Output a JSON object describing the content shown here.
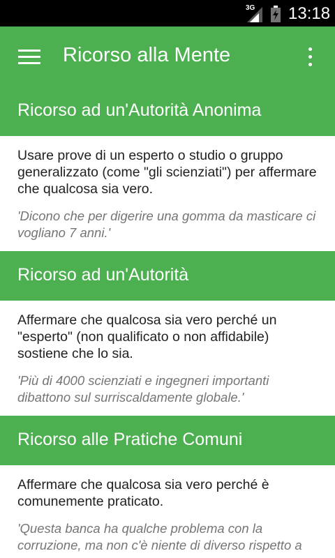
{
  "status_bar": {
    "network": "3G",
    "time": "13:18"
  },
  "app_bar": {
    "title": "Ricorso alla Mente"
  },
  "fallacies": [
    {
      "title": "Ricorso ad un'Autorità Anonima",
      "description": "Usare prove di un esperto o studio o gruppo generalizzato (come \"gli scienziati\") per affermare che qualcosa sia vero.",
      "example": "'Dicono che per digerire una gomma da masticare ci vogliano 7 anni.'"
    },
    {
      "title": "Ricorso ad un'Autorità",
      "description": "Affermare che qualcosa sia vero perché un \"esperto\" (non qualificato o non affidabile) sostiene che lo sia.",
      "example": "'Più di 4000 scienziati e ingegneri importanti dibattono sul surriscaldamente globale.'"
    },
    {
      "title": "Ricorso alle Pratiche Comuni",
      "description": "Affermare che qualcosa sia vero perché è comunemente praticato.",
      "example": "'Questa banca ha qualche problema con la corruzione, ma non c'è niente di diverso rispetto a"
    }
  ],
  "colors": {
    "primary": "#4caf50",
    "status_bar": "#000000",
    "text": "#212121",
    "example_text": "#757575"
  },
  "icons": {
    "menu": "hamburger-menu-icon",
    "overflow": "more-vertical-icon",
    "signal": "signal-icon",
    "battery": "battery-charging-icon"
  }
}
